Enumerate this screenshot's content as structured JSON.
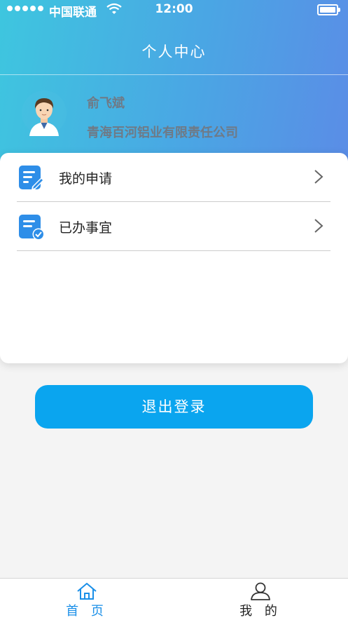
{
  "status_bar": {
    "carrier": "中国联通",
    "time": "12:00"
  },
  "nav": {
    "title": "个人中心"
  },
  "profile": {
    "name": "俞飞斌",
    "company": "青海百河铝业有限责任公司"
  },
  "menu": {
    "items": [
      {
        "label": "我的申请",
        "icon": "edit-document-icon"
      },
      {
        "label": "已办事宜",
        "icon": "completed-document-icon"
      }
    ]
  },
  "logout_label": "退出登录",
  "tabbar": {
    "items": [
      {
        "label": "首 页",
        "icon": "home-icon",
        "active": true
      },
      {
        "label": "我 的",
        "icon": "user-icon",
        "active": false
      }
    ]
  },
  "colors": {
    "header_start": "#3ec6df",
    "header_end": "#5b8ce6",
    "accent": "#0aa5ef",
    "tab_active": "#1a8fe8"
  }
}
